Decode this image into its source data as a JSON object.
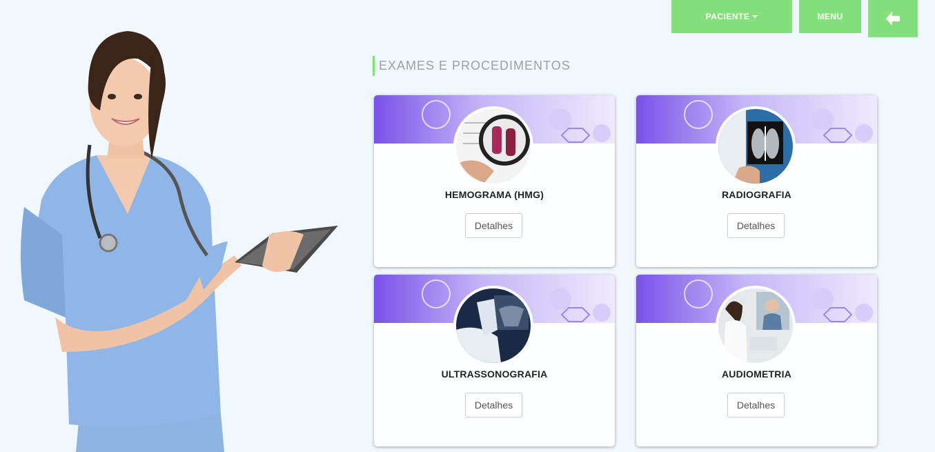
{
  "nav": {
    "paciente_label": "PACIENTE",
    "menu_label": "MENU",
    "back_icon": "arrow-left-icon"
  },
  "section": {
    "title": "EXAMES E PROCEDIMENTOS"
  },
  "cards": [
    {
      "title": "HEMOGRAMA (HMG)",
      "button": "Detalhes",
      "image": "blood-test-magnifier-image"
    },
    {
      "title": "RADIOGRAFIA",
      "button": "Detalhes",
      "image": "xray-doctor-image"
    },
    {
      "title": "ULTRASSONOGRAFIA",
      "button": "Detalhes",
      "image": "ultrasound-probe-image"
    },
    {
      "title": "AUDIOMETRIA",
      "button": "Detalhes",
      "image": "audiometry-booth-image"
    }
  ],
  "colors": {
    "accent": "#84e07a",
    "background": "#f0f7fd",
    "banner": "#8a5cf0"
  }
}
